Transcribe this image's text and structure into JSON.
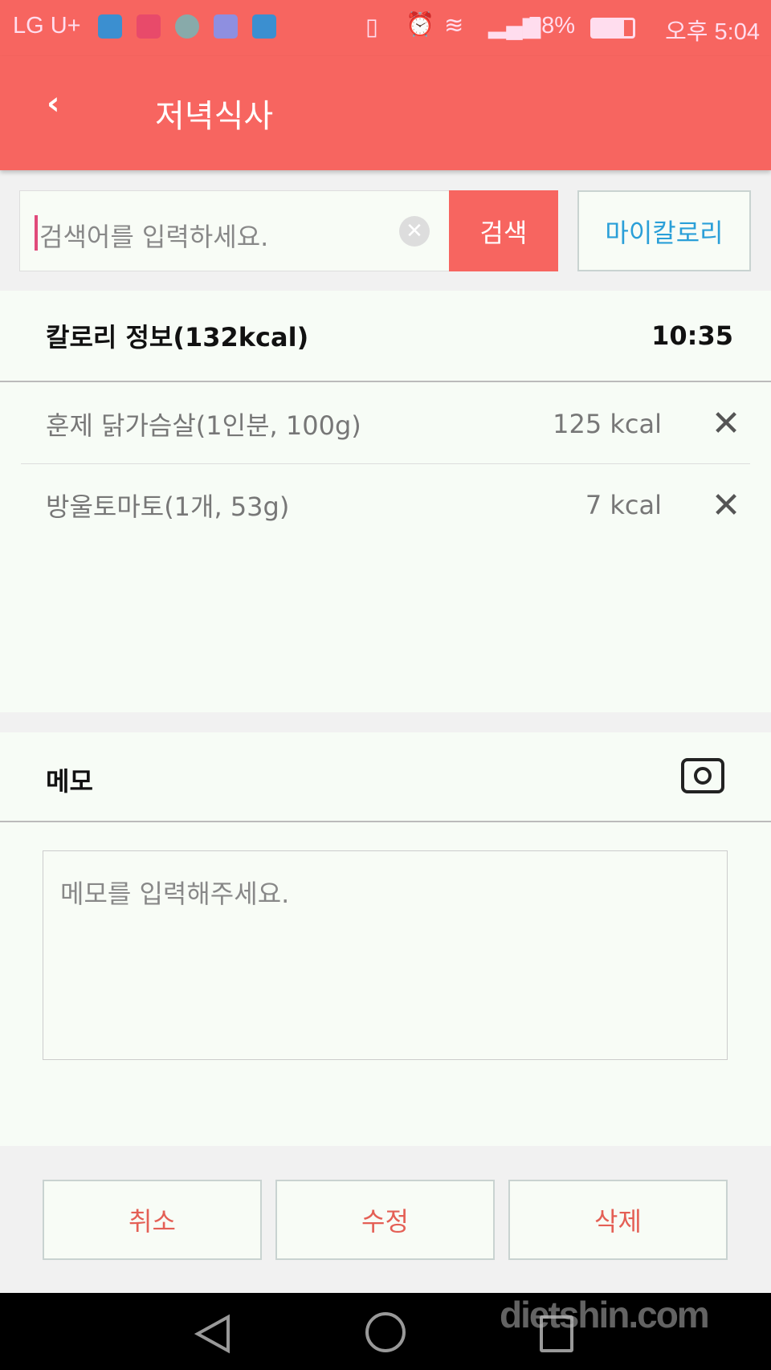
{
  "status_bar": {
    "carrier": "LG U+",
    "battery": "78%",
    "time": "오후 5:04"
  },
  "header": {
    "title": "저녁식사",
    "back_icon": "chevron-left-icon"
  },
  "search": {
    "placeholder": "검색어를 입력하세요.",
    "value": "",
    "button": "검색",
    "my_calorie": "마이칼로리"
  },
  "calorie": {
    "title": "칼로리 정보(132kcal)",
    "time": "10:35",
    "items": [
      {
        "name": "훈제 닭가슴살(1인분, 100g)",
        "kcal": "125 kcal"
      },
      {
        "name": "방울토마토(1개, 53g)",
        "kcal": "7 kcal"
      }
    ]
  },
  "memo": {
    "title": "메모",
    "placeholder": "메모를 입력해주세요.",
    "value": ""
  },
  "actions": {
    "cancel": "취소",
    "edit": "수정",
    "delete": "삭제"
  },
  "watermark": "dietshin.com",
  "colors": {
    "accent": "#f76560",
    "link": "#2a9fd8"
  }
}
